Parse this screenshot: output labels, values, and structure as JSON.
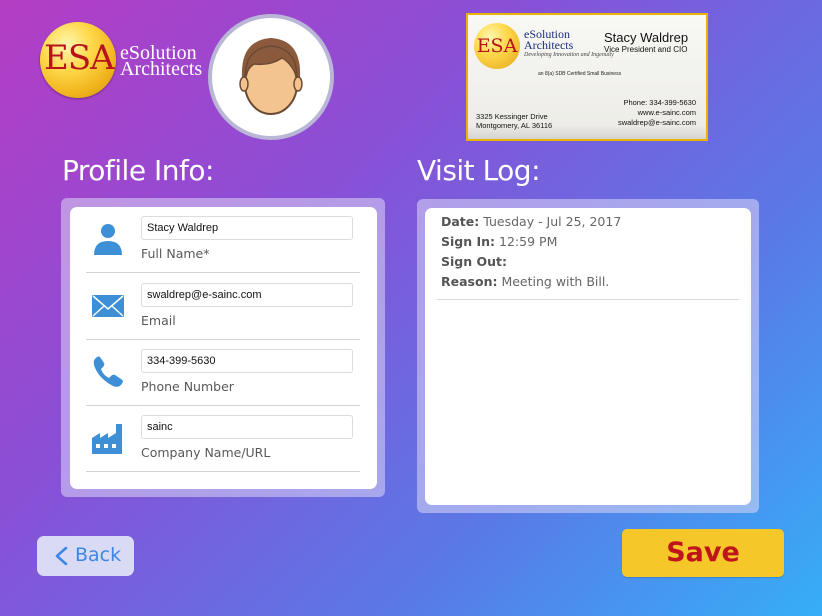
{
  "logo": {
    "letters": "ESA",
    "line1": "eSolution",
    "line2": "Architects"
  },
  "avatar": {
    "icon": "person-avatar-icon"
  },
  "business_card": {
    "logo_letters": "ESA",
    "company_line1": "eSolution",
    "company_line2": "Architects",
    "tagline": "Developing Innovation and Ingenuity",
    "name": "Stacy Waldrep",
    "title": "Vice President and CIO",
    "certification": "an 8(a) SDB Certified Small Business",
    "address_line1": "3325 Kessinger Drive",
    "address_line2": "Montgomery, AL 36116",
    "phone": "Phone: 334-399-5630",
    "website": "www.e-sainc.com",
    "email": "swaldrep@e-sainc.com"
  },
  "profile": {
    "heading": "Profile Info:",
    "fields": [
      {
        "icon": "person-icon",
        "value": "Stacy Waldrep",
        "label": "Full Name*"
      },
      {
        "icon": "envelope-icon",
        "value": "swaldrep@e-sainc.com",
        "label": "Email"
      },
      {
        "icon": "phone-icon",
        "value": "334-399-5630",
        "label": "Phone Number"
      },
      {
        "icon": "factory-icon",
        "value": "sainc",
        "label": "Company Name/URL"
      }
    ]
  },
  "visit_log": {
    "heading": "Visit Log:",
    "entries": [
      {
        "date_label": "Date:",
        "date_value": "Tuesday - Jul 25, 2017",
        "signin_label": "Sign In:",
        "signin_value": "12:59 PM",
        "signout_label": "Sign Out:",
        "signout_value": "",
        "reason_label": "Reason:",
        "reason_value": "Meeting with Bill."
      }
    ]
  },
  "buttons": {
    "back": "Back",
    "save": "Save"
  },
  "colors": {
    "accent_blue": "#3d86e6",
    "save_bg": "#f5c728",
    "save_text": "#c0141c",
    "icon_blue": "#3d8fd6"
  }
}
